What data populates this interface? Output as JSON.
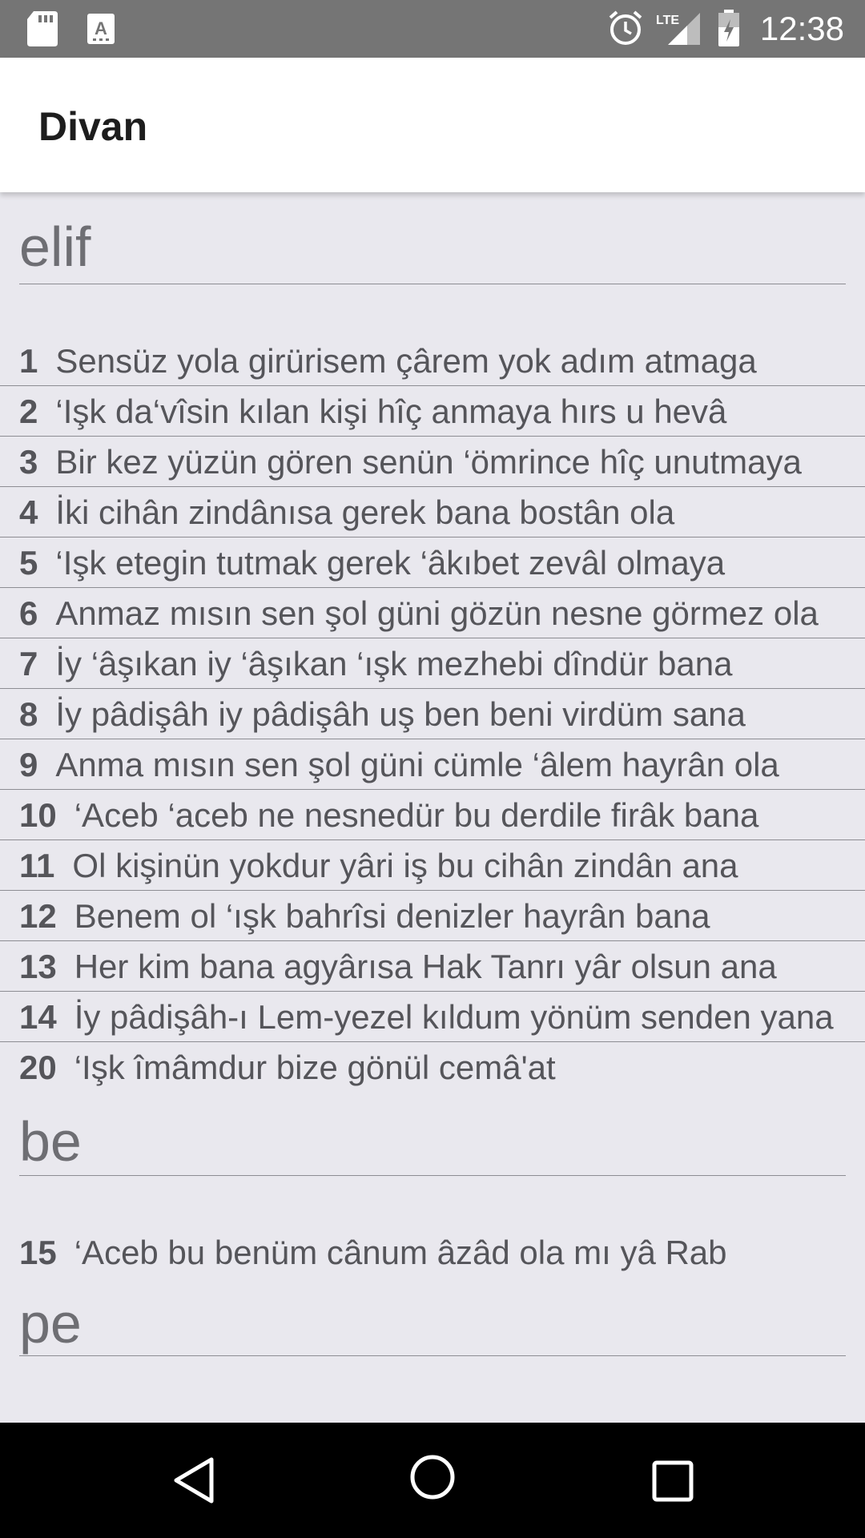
{
  "status_bar": {
    "time": "12:38",
    "network": "LTE",
    "icons": [
      "sd-card-icon",
      "keyboard-a-icon",
      "alarm-icon",
      "signal-icon",
      "battery-charging-icon"
    ]
  },
  "app_bar": {
    "title": "Divan"
  },
  "sections": [
    {
      "header": "elif",
      "rows": [
        {
          "num": "1",
          "text": "Sensüz yola girürisem çârem yok adım atmaga"
        },
        {
          "num": "2",
          "text": "‘Işk da‘vîsin kılan kişi hîç anmaya hırs u hevâ"
        },
        {
          "num": "3",
          "text": "Bir kez yüzün gören senün ‘ömrince hîç unutmaya"
        },
        {
          "num": "4",
          "text": "İki cihân zindânısa gerek bana bostân ola"
        },
        {
          "num": "5",
          "text": "‘Işk etegin tutmak gerek ‘âkıbet zevâl olmaya"
        },
        {
          "num": "6",
          "text": "Anmaz mısın sen şol güni gözün nesne görmez ola"
        },
        {
          "num": "7",
          "text": "İy ‘âşıkan iy ‘âşıkan ‘ışk mezhebi dîndür bana"
        },
        {
          "num": "8",
          "text": "İy pâdişâh iy pâdişâh uş ben beni virdüm sana"
        },
        {
          "num": "9",
          "text": "Anma mısın sen şol güni cümle ‘âlem hayrân ola"
        },
        {
          "num": "10",
          "text": "‘Aceb ‘aceb ne nesnedür bu derdile firâk bana"
        },
        {
          "num": "11",
          "text": "Ol kişinün yokdur yâri iş bu cihân zindân ana"
        },
        {
          "num": "12",
          "text": "Benem ol ‘ışk bahrîsi denizler hayrân bana"
        },
        {
          "num": "13",
          "text": "Her kim bana agyârısa Hak Tanrı yâr olsun ana"
        },
        {
          "num": "14",
          "text": "İy pâdişâh-ı Lem-yezel kıldum yönüm senden yana"
        },
        {
          "num": "20",
          "text": "‘Işk îmâmdur bize gönül cemâ'at"
        }
      ]
    },
    {
      "header": "be",
      "rows": [
        {
          "num": "15",
          "text": "‘Aceb bu benüm cânum âzâd ola mı yâ Rab"
        }
      ]
    },
    {
      "header": "pe",
      "rows": []
    }
  ]
}
